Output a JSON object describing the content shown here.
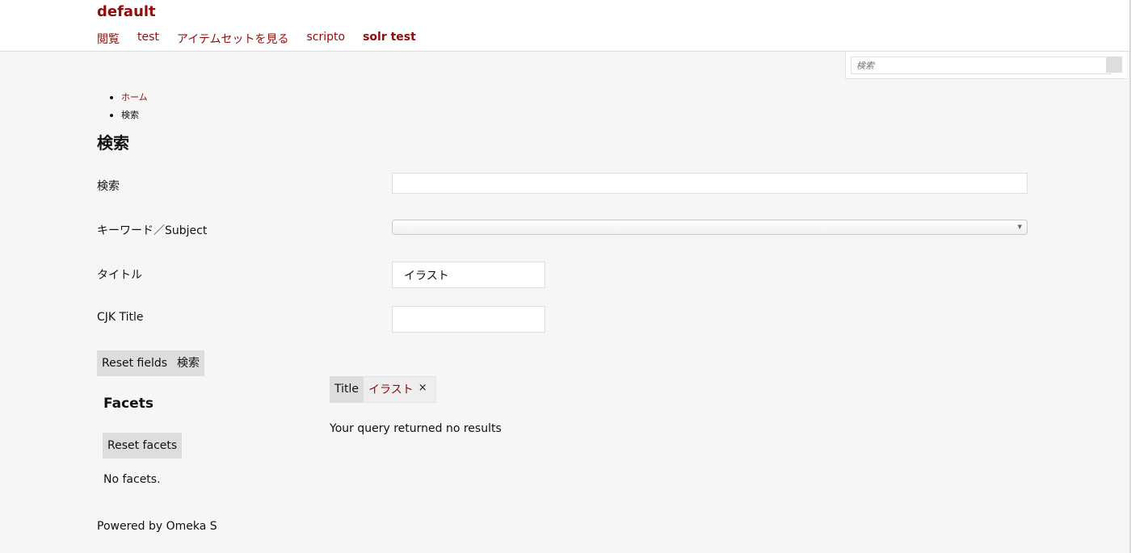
{
  "header": {
    "site_title": "default",
    "nav": [
      {
        "label": "閲覧"
      },
      {
        "label": "test"
      },
      {
        "label": "アイテムセットを見る"
      },
      {
        "label": "scripto"
      },
      {
        "label": "solr test"
      }
    ]
  },
  "site_search": {
    "placeholder": "検索"
  },
  "breadcrumbs": [
    {
      "label": "ホーム"
    },
    {
      "label": "検索"
    }
  ],
  "page_title": "検索",
  "form": {
    "fields": [
      {
        "label": "検索",
        "value": ""
      },
      {
        "label": "キーワード／Subject",
        "value": ""
      },
      {
        "label": "タイトル",
        "value": "イラスト"
      },
      {
        "label": "CJK Title",
        "value": ""
      }
    ],
    "reset_label": "Reset fields",
    "submit_label": "検索"
  },
  "facets": {
    "title": "Facets",
    "reset_label": "Reset facets",
    "empty_text": "No facets."
  },
  "active_filter": {
    "label": "Title",
    "value": "イラスト",
    "remove_symbol": "×"
  },
  "results": {
    "empty_text": "Your query returned no results"
  },
  "footer": {
    "text": "Powered by Omeka S"
  },
  "colors": {
    "accent": "#920b0b",
    "background": "#f6f6f6",
    "button": "#dddddd"
  }
}
